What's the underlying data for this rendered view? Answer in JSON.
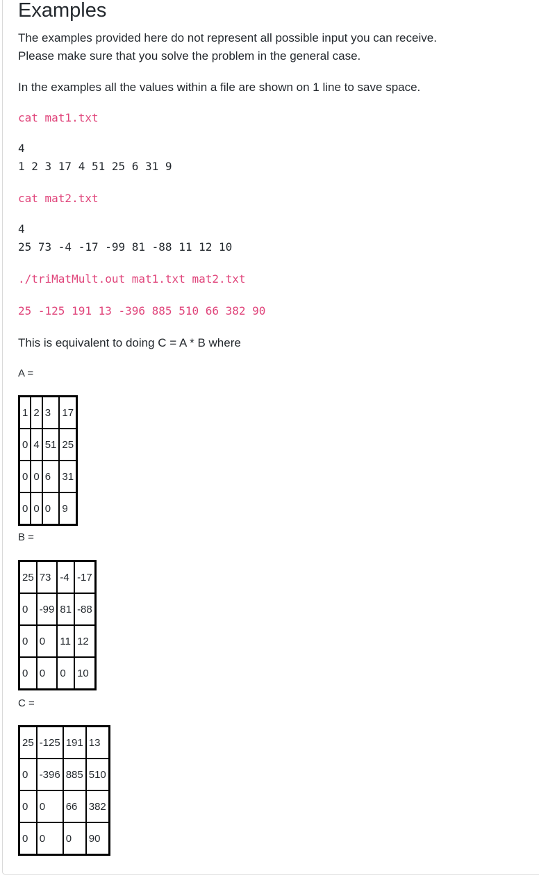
{
  "heading": "Examples",
  "intro": {
    "line1": "The examples provided here do not represent all possible input you can receive.",
    "line2": "Please make sure that you solve the problem in the general case."
  },
  "note": "In the examples all the values within a file are shown on 1 line to save space.",
  "blocks": [
    {
      "command": "cat mat1.txt",
      "output": [
        "4",
        "1 2 3 17 4 51 25 6 31 9"
      ]
    },
    {
      "command": "cat mat2.txt",
      "output": [
        "4",
        "25 73 -4 -17 -99 81 -88 11 12 10"
      ]
    }
  ],
  "run": {
    "command": "./triMatMult.out mat1.txt mat2.txt",
    "output": "25 -125 191 13 -396 885 510 66 382 90"
  },
  "explanation": "This is equivalent to doing C = A * B where",
  "matrices": {
    "A": {
      "label": "A =",
      "rows": [
        [
          "1",
          "2",
          "3",
          "17"
        ],
        [
          "0",
          "4",
          "51",
          "25"
        ],
        [
          "0",
          "0",
          "6",
          "31"
        ],
        [
          "0",
          "0",
          "0",
          "9"
        ]
      ]
    },
    "B": {
      "label": "B =",
      "rows": [
        [
          "25",
          "73",
          "-4",
          "-17"
        ],
        [
          "0",
          "-99",
          "81",
          "-88"
        ],
        [
          "0",
          "0",
          "11",
          "12"
        ],
        [
          "0",
          "0",
          "0",
          "10"
        ]
      ]
    },
    "C": {
      "label": "C =",
      "rows": [
        [
          "25",
          "-125",
          "191",
          "13"
        ],
        [
          "0",
          "-396",
          "885",
          "510"
        ],
        [
          "0",
          "0",
          "66",
          "382"
        ],
        [
          "0",
          "0",
          "0",
          "90"
        ]
      ]
    }
  }
}
